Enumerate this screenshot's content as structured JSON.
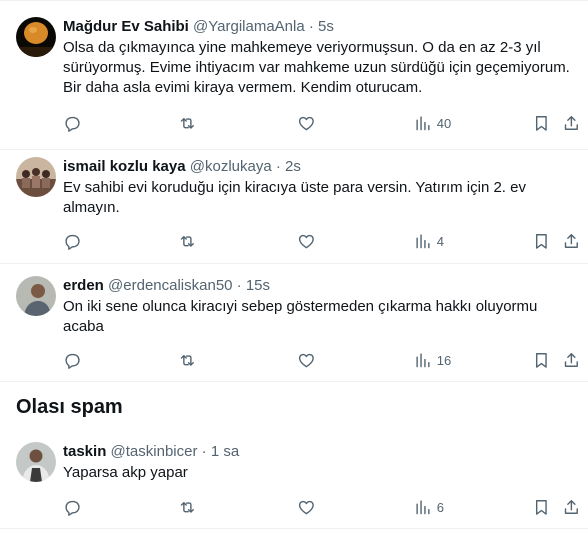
{
  "tweets": [
    {
      "name": "Mağdur Ev Sahibi",
      "handle": "@YargilamaAnla",
      "dot": "·",
      "time": "5s",
      "text": "Olsa da çıkmayınca yine mahkemeye veriyormuşsun. O da en az 2-3 yıl sürüyormuş. Evime ihtiyacım var mahkeme uzun sürdüğü için geçemiyorum. Bir daha asla evimi kiraya vermem. Kendim oturucam.",
      "views": "40",
      "avatar_icon": "moon-avatar-icon"
    },
    {
      "name": "ismail kozlu kaya",
      "handle": "@kozlukaya",
      "dot": "·",
      "time": "2s",
      "text": "Ev sahibi evi koruduğu için kiracıya üste para versin. Yatırım için 2. ev almayın.",
      "views": "4",
      "avatar_icon": "group-photo-avatar-icon"
    },
    {
      "name": "erden",
      "handle": "@erdencaliskan50",
      "dot": "·",
      "time": "15s",
      "text": "On iki sene olunca kiracıyi sebep göstermeden çıkarma hakkı oluyormu acaba",
      "views": "16",
      "avatar_icon": "person-avatar-icon"
    }
  ],
  "spam_section": {
    "title": "Olası spam",
    "tweet": {
      "name": "taskin",
      "handle": "@taskinbicer",
      "dot": "·",
      "time": "1 sa",
      "text": "Yaparsa akp yapar",
      "views": "6",
      "avatar_icon": "person-avatar-icon"
    }
  },
  "colors": {
    "text": "#0f1419",
    "secondary": "#536471",
    "divider": "#eff3f4"
  }
}
